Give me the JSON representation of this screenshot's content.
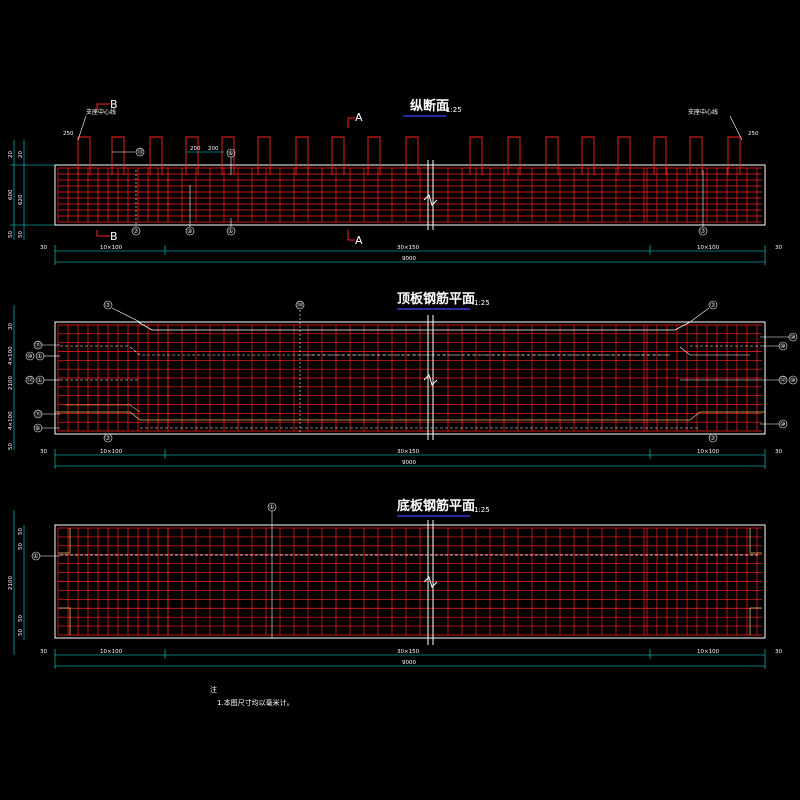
{
  "colors": {
    "background": "#000000",
    "outline": "#ffffff",
    "rebar": "#ff2020",
    "dimension": "#00e5e5",
    "title_underline": "#4040ff",
    "accent": "#e0c060"
  },
  "views": {
    "longitudinal": {
      "title": "纵断面",
      "scale": "1:25",
      "support_left": "支座中心线",
      "support_right": "支座中心线",
      "section_b": "B",
      "section_a": "A",
      "spacing_a": "200",
      "spacing_b": "200",
      "stirrup_spacing": "250",
      "side_dims": [
        "20",
        "600",
        "50"
      ],
      "side_dims_b": [
        "20",
        "620",
        "50"
      ],
      "leaders": [
        "⑦",
        "②",
        "①",
        "⑦",
        "⑫",
        "⑥",
        "⑬"
      ],
      "dims_row1": [
        "30",
        "10×100",
        "30×150",
        "10×100",
        "30"
      ],
      "total": "9000"
    },
    "top_slab": {
      "title": "顶板钢筋平面",
      "scale": "1:25",
      "leaders_left": [
        "⑪",
        "⑩",
        "①",
        "⑫",
        "⑪",
        "⑥"
      ],
      "leaders_right": [
        "⑩",
        "⑩",
        "⑫",
        "⑩"
      ],
      "leader_top": [
        "⑦",
        "⑭",
        "⑦"
      ],
      "leader_bottom": [
        "⑦",
        "⑦"
      ],
      "side_dims": [
        "30",
        "4×100",
        "2100",
        "4×100",
        "50"
      ],
      "dims_row1": [
        "30",
        "10×100",
        "30×150",
        "10×100",
        "30"
      ],
      "total": "9000"
    },
    "bottom_slab": {
      "title": "底板钢筋平面",
      "scale": "1:25",
      "leader_top": "①",
      "leader_left": "①",
      "side_dims": [
        "50",
        "50",
        "2100",
        "50",
        "50"
      ],
      "dims_row1": [
        "30",
        "10×100",
        "30×150",
        "10×100",
        "30"
      ],
      "total": "9000"
    }
  },
  "notes": {
    "heading": "注",
    "items": [
      "1.本图尺寸均以毫米计。"
    ]
  }
}
